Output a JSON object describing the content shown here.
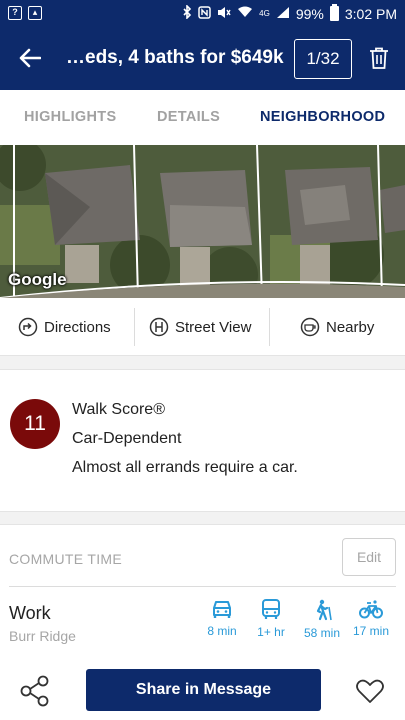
{
  "status_bar": {
    "battery_percent": "99%",
    "time": "3:02 PM",
    "network_label": "4G",
    "left_icons": [
      "help-box-icon",
      "image-icon"
    ],
    "right_icons": [
      "bluetooth-icon",
      "nfc-icon",
      "mute-icon",
      "wifi-icon",
      "signal-icon",
      "battery-icon"
    ]
  },
  "header": {
    "title": "…eds, 4 baths for $649k",
    "counter": "1/32",
    "back_icon": "arrow-left-icon",
    "delete_icon": "trash-icon"
  },
  "tabs": [
    {
      "label": "HIGHLIGHTS",
      "active": false
    },
    {
      "label": "DETAILS",
      "active": false
    },
    {
      "label": "NEIGHBORHOOD",
      "active": true
    }
  ],
  "map": {
    "attribution": "Google"
  },
  "map_actions": [
    {
      "label": "Directions",
      "icon": "directions-icon"
    },
    {
      "label": "Street View",
      "icon": "street-view-icon"
    },
    {
      "label": "Nearby",
      "icon": "nearby-icon"
    }
  ],
  "walk_score": {
    "score": "11",
    "title": "Walk Score®",
    "category": "Car-Dependent",
    "description": "Almost all errands require a car.",
    "color": "#7a0a0a"
  },
  "commute": {
    "label": "COMMUTE TIME",
    "edit_label": "Edit",
    "destination": "Work",
    "location": "Burr Ridge",
    "modes": [
      {
        "icon": "car-icon",
        "time": "8 min"
      },
      {
        "icon": "bus-icon",
        "time": "1+ hr"
      },
      {
        "icon": "walk-icon",
        "time": "58 min"
      },
      {
        "icon": "bike-icon",
        "time": "17 min"
      }
    ],
    "accent_color": "#2a9ad8"
  },
  "bottom_bar": {
    "share_button_label": "Share in Message",
    "share_icon": "share-icon",
    "favorite_icon": "heart-icon"
  },
  "colors": {
    "primary": "#0d2a6b",
    "tab_inactive": "#a2a2a2",
    "muted_text": "#a6a6a6"
  }
}
